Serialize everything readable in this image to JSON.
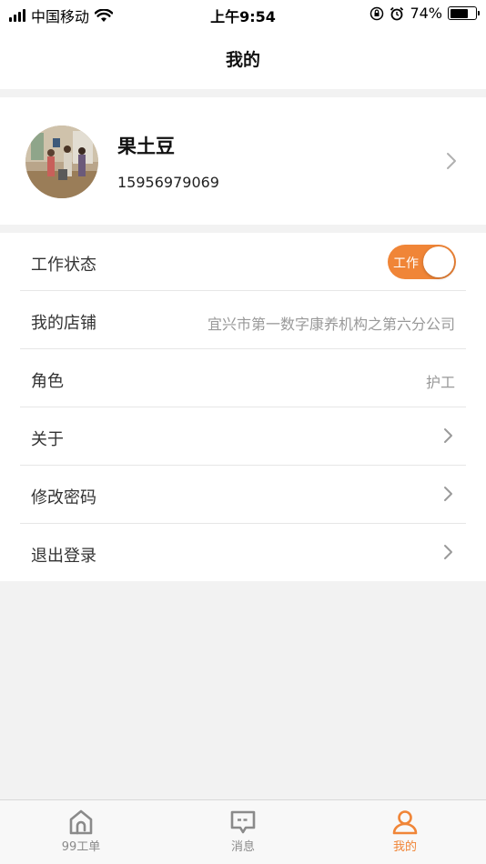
{
  "status_bar": {
    "carrier": "中国移动",
    "time": "上午9:54",
    "battery_percent": "74%",
    "battery_level": 0.74
  },
  "nav": {
    "title": "我的"
  },
  "profile": {
    "name": "果土豆",
    "phone": "15956979069"
  },
  "settings": {
    "work_status": {
      "label": "工作状态",
      "toggle_text": "工作",
      "on": true
    },
    "store": {
      "label": "我的店铺",
      "value": "宜兴市第一数字康养机构之第六分公司"
    },
    "role": {
      "label": "角色",
      "value": "护工"
    },
    "about": {
      "label": "关于"
    },
    "change_password": {
      "label": "修改密码"
    },
    "logout": {
      "label": "退出登录"
    }
  },
  "tabs": [
    {
      "label": "99工单",
      "icon": "home-icon"
    },
    {
      "label": "消息",
      "icon": "message-icon"
    },
    {
      "label": "我的",
      "icon": "person-icon",
      "active": true
    }
  ],
  "colors": {
    "accent": "#f08537",
    "background": "#f2f2f2",
    "inactive": "#8a8a8a"
  }
}
